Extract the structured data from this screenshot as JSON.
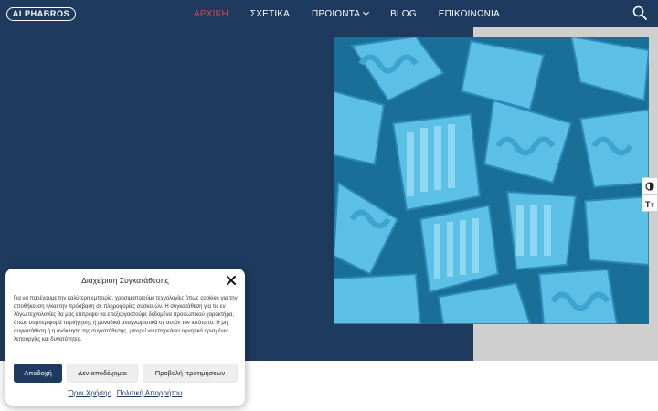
{
  "header": {
    "logo_text": "ALPHABROS",
    "nav": [
      {
        "label": "ΑΡΧΙΚΗ",
        "active": true
      },
      {
        "label": "ΣΧΕΤΙΚΑ"
      },
      {
        "label": "ΠΡΟΙΟΝΤΑ",
        "has_dropdown": true
      },
      {
        "label": "BLOG"
      },
      {
        "label": "ΕΠΙΚΟΙΝΩΝΙΑ"
      }
    ],
    "search_icon": "search-icon"
  },
  "colors": {
    "primary": "#1e3a5f",
    "active_nav": "#e0474c",
    "hero_gray": "#cfcfcf",
    "image_blue": "#4fb3dc"
  },
  "side_tools": {
    "contrast_icon": "contrast-icon",
    "font_size_icon": "font-size-icon"
  },
  "cookie": {
    "title": "Διαχείριση Συγκατάθεσης",
    "body": "Για να παρέχουμε την καλύτερη εμπειρία, χρησιμοποιούμε τεχνολογίες όπως cookies για την αποθήκευση ή/και την πρόσβαση σε πληροφορίες συσκευών. Η συγκατάθεση για τις εν λόγω τεχνολογίες θα μας επιτρέψει να επεξεργαστούμε δεδομένα προσωπικού χαρακτήρα, όπως συμπεριφορά περιήγησης ή μοναδικά αναγνωριστικά σε αυτόν τον ιστότοπο. Η μη συγκατάθεση ή η ανάκληση της συγκατάθεσης, μπορεί να επηρεάσει αρνητικά ορισμένες λειτουργίες και δυνατότητες.",
    "accept_label": "Αποδοχή",
    "deny_label": "Δεν αποδέχομαι",
    "prefs_label": "Προβολή προτιμήσεων",
    "terms_link": "Όροι Χρήσης",
    "privacy_link": "Πολιτική Απορρήτου"
  }
}
